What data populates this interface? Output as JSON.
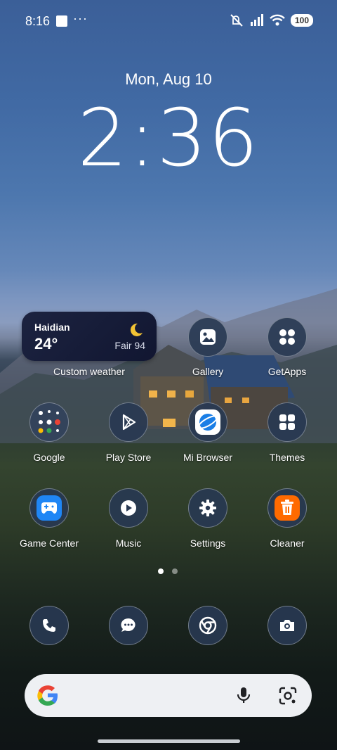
{
  "status_bar": {
    "time": "8:16",
    "overflow": "···",
    "battery": "100",
    "icons": [
      "mute-icon",
      "signal-icon",
      "wifi-icon"
    ]
  },
  "lockscreen": {
    "date": "Mon, Aug 10",
    "time": "2:36"
  },
  "weather_widget": {
    "city": "Haidian",
    "temperature": "24°",
    "condition": "Fair 94",
    "label": "Custom weather"
  },
  "apps": {
    "gallery": "Gallery",
    "getapps": "GetApps",
    "google": "Google",
    "play_store": "Play Store",
    "mi_browser": "Mi Browser",
    "themes": "Themes",
    "game_center": "Game Center",
    "music": "Music",
    "settings": "Settings",
    "cleaner": "Cleaner"
  },
  "pages": {
    "count": 2,
    "current": 1
  },
  "dock": [
    "phone-icon",
    "messages-icon",
    "chrome-icon",
    "camera-icon"
  ],
  "colors": {
    "icon_bg": "#283852",
    "cleaner": "#ff6a00",
    "browser": "#1a7ee6",
    "game": "#1f86f5"
  }
}
